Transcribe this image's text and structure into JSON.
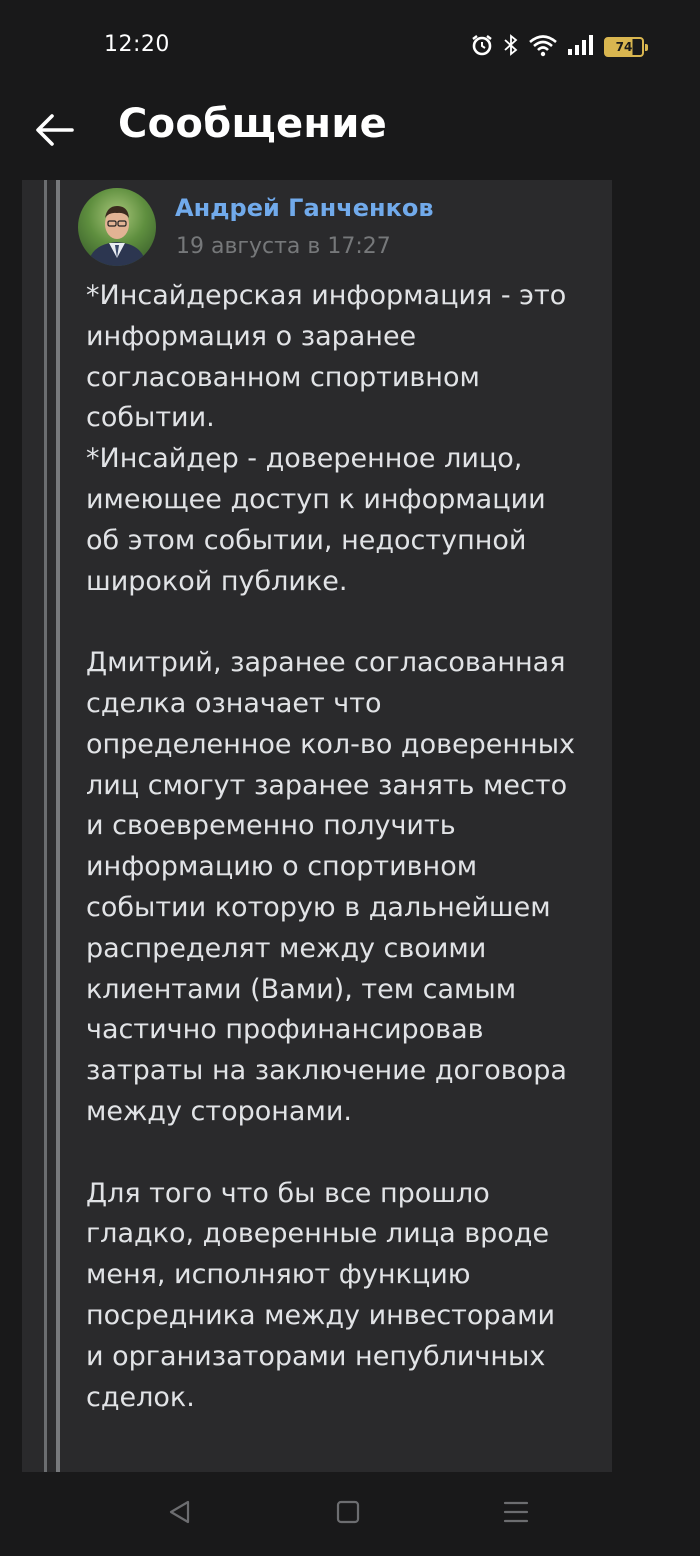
{
  "status_bar": {
    "time": "12:20",
    "battery_level": "74",
    "icons": [
      "alarm-icon",
      "bluetooth-icon",
      "wifi-icon",
      "signal-icon",
      "battery-icon"
    ]
  },
  "app_bar": {
    "title": "Сообщение",
    "back_icon": "arrow-left-icon"
  },
  "post": {
    "author": "Андрей Ганченков",
    "date": "19 августа в 17:27",
    "paragraphs": [
      [
        "*Инсайдерская информация - это",
        "информация о заранее",
        "согласованном спортивном",
        "событии.",
        "*Инсайдер - доверенное лицо,",
        "имеющее доступ к информации",
        "об этом событии, недоступной",
        "широкой публике."
      ],
      [
        "Дмитрий, заранее согласованная",
        "сделка означает что",
        "определенное кол-во доверенных",
        "лиц смогут заранее занять место",
        "и своевременно получить",
        "информацию о спортивном",
        "событии которую в дальнейшем",
        "распределят между своими",
        "клиентами (Вами), тем самым",
        "частично профинансировав",
        "затраты на заключение договора",
        "между сторонами."
      ],
      [
        "Для того что бы все прошло",
        "гладко, доверенные лица вроде",
        "меня, исполняют функцию",
        "посредника между инвесторами",
        "и организаторами непубличных",
        "сделок."
      ]
    ]
  },
  "colors": {
    "background": "#19191a",
    "card": "#2a2a2c",
    "author_link": "#71aaeb",
    "muted": "#76787a",
    "battery": "#d9b650"
  },
  "nav": {
    "icons": [
      "back-triangle-icon",
      "home-square-icon",
      "recents-menu-icon"
    ]
  }
}
